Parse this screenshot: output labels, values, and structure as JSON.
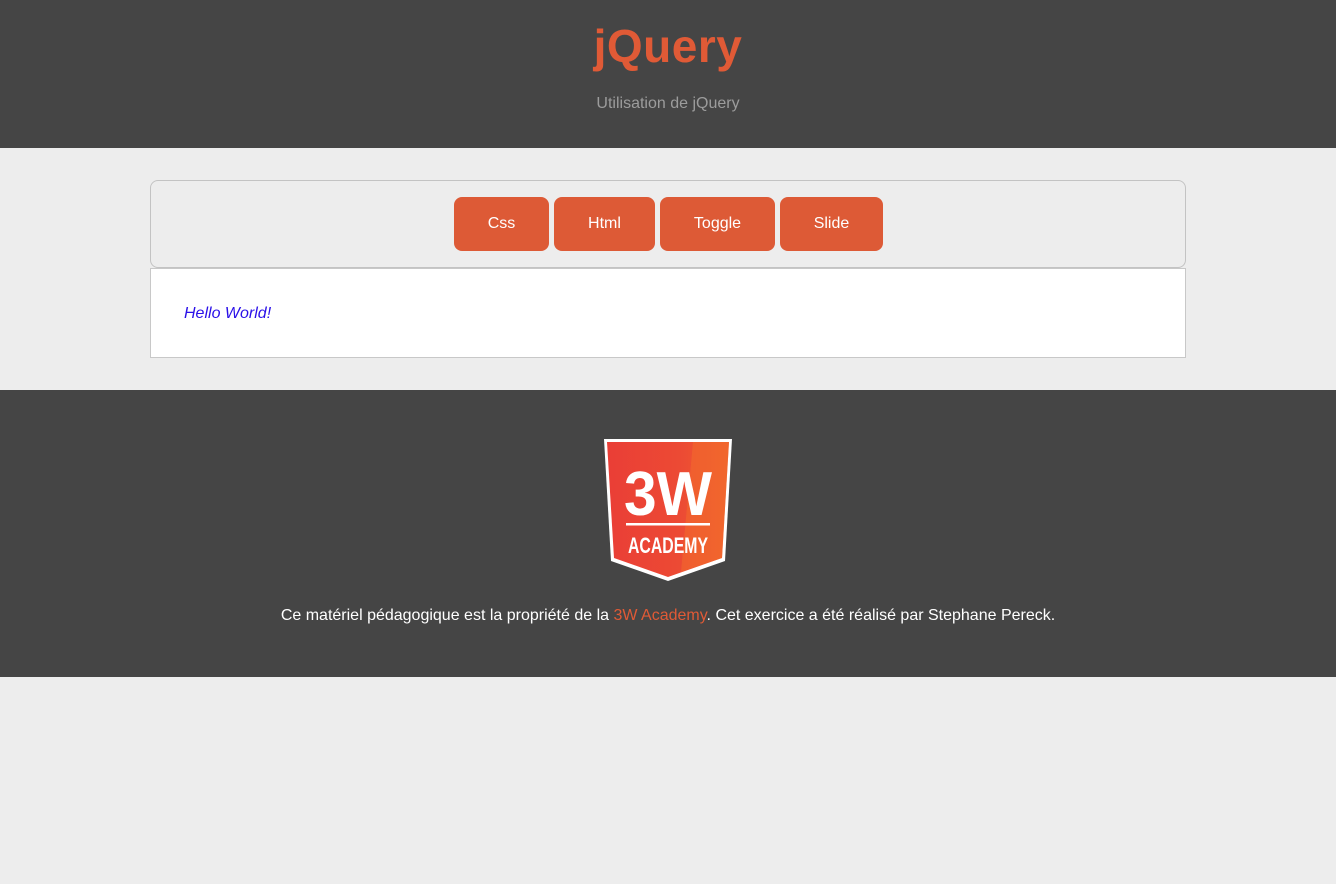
{
  "header": {
    "title": "jQuery",
    "subtitle": "Utilisation de jQuery"
  },
  "toolbar": {
    "buttons": [
      {
        "label": "Css"
      },
      {
        "label": "Html"
      },
      {
        "label": "Toggle"
      },
      {
        "label": "Slide"
      }
    ]
  },
  "output": {
    "text": "Hello World!"
  },
  "footer": {
    "logo_text_top": "3W",
    "logo_text_bottom": "ACADEMY",
    "text_before": "Ce matériel pédagogique est la propriété de la ",
    "link_text": "3W Academy",
    "text_after": ". Cet exercice a été réalisé par Stephane Pereck."
  },
  "colors": {
    "accent": "#dd5a36",
    "header_bg": "#454545",
    "page_bg": "#ededed",
    "output_text": "#2a10e8"
  }
}
